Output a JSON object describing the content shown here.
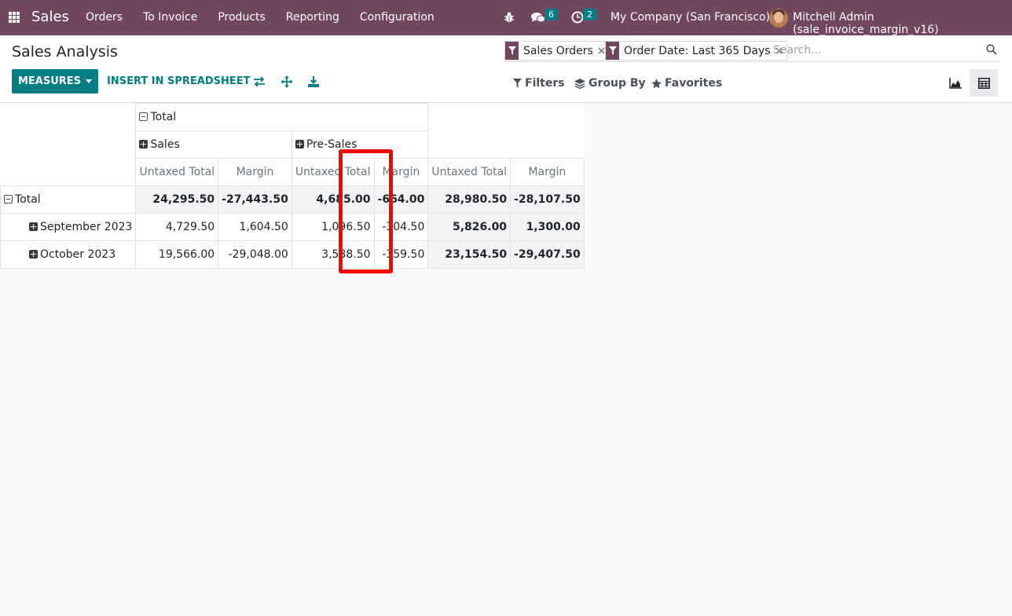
{
  "navbar": {
    "brand": "Sales",
    "menu": [
      "Orders",
      "To Invoice",
      "Products",
      "Reporting",
      "Configuration"
    ],
    "messages_count": "6",
    "activities_count": "2",
    "company": "My Company (San Francisco)",
    "user": "Mitchell Admin (sale_invoice_margin_v16)"
  },
  "control": {
    "title": "Sales Analysis",
    "measures_label": "MEASURES",
    "insert_label": "INSERT IN SPREADSHEET",
    "facets": [
      "Sales Orders",
      "Order Date: Last 365 Days"
    ],
    "search_placeholder": "Search...",
    "filters_label": "Filters",
    "groupby_label": "Group By",
    "favorites_label": "Favorites"
  },
  "pivot": {
    "col_root": "Total",
    "col_groups": [
      "Sales",
      "Pre-Sales"
    ],
    "measures": [
      "Untaxed Total",
      "Margin",
      "Untaxed Total",
      "Margin",
      "Untaxed Total",
      "Margin"
    ],
    "rows": [
      {
        "label": "Total",
        "values": [
          "24,295.50",
          "-27,443.50",
          "4,685.00",
          "-664.00",
          "28,980.50",
          "-28,107.50"
        ]
      },
      {
        "label": "September 2023",
        "values": [
          "4,729.50",
          "1,604.50",
          "1,096.50",
          "-304.50",
          "5,826.00",
          "1,300.00"
        ]
      },
      {
        "label": "October 2023",
        "values": [
          "19,566.00",
          "-29,048.00",
          "3,588.50",
          "-359.50",
          "23,154.50",
          "-29,407.50"
        ]
      }
    ]
  },
  "colors": {
    "navbar": "#71465f",
    "primary": "#017e84",
    "highlight": "#ff0000"
  },
  "icons": [
    "apps-icon",
    "bug-icon",
    "chat-icon",
    "clock-icon",
    "avatar",
    "caret-down-icon",
    "flip-axis-icon",
    "expand-icon",
    "download-icon",
    "filter-icon",
    "close-icon",
    "search-icon",
    "layers-icon",
    "star-icon",
    "graph-view-icon",
    "pivot-view-icon"
  ]
}
